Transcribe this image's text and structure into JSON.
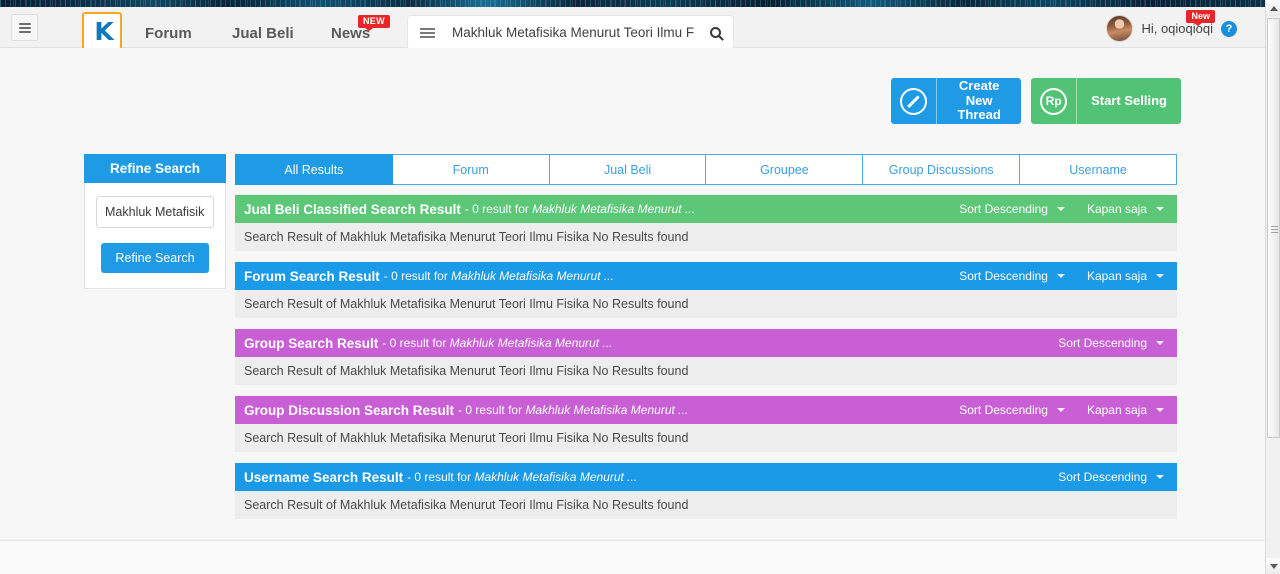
{
  "header": {
    "menu_icon": "hamburger-icon",
    "logo_glyph": "K",
    "nav": [
      {
        "label": "Forum"
      },
      {
        "label": "Jual Beli"
      },
      {
        "label": "News",
        "badge": "NEW"
      }
    ],
    "search": {
      "menu_icon": "hamburger-icon",
      "value": "Makhluk Metafisika Menurut Teori Ilmu Fisika",
      "placeholder": "Search",
      "button_icon": "search-icon"
    },
    "user": {
      "greeting": "Hi, oqioqioqi",
      "badge": "New",
      "help_label": "?",
      "avatar_icon": "avatar-image"
    }
  },
  "actions": [
    {
      "icon": "pencil-icon",
      "label": "Create New Thread",
      "color": "#1f9ae5"
    },
    {
      "icon": "rupiah-icon",
      "icon_text": "Rp",
      "label": "Start Selling",
      "color": "#52c375"
    }
  ],
  "sidebar": {
    "heading": "Refine Search",
    "input_value": "Makhluk Metafisika Menurut Teori Ilmu Fisika",
    "input_placeholder": "Search keyword",
    "button_label": "Refine Search"
  },
  "tabs": [
    {
      "label": "All Results",
      "active": true
    },
    {
      "label": "Forum",
      "active": false
    },
    {
      "label": "Jual Beli",
      "active": false
    },
    {
      "label": "Groupee",
      "active": false
    },
    {
      "label": "Group Discussions",
      "active": false
    },
    {
      "label": "Username",
      "active": false
    }
  ],
  "results": [
    {
      "title": "Jual Beli Classified Search Result",
      "meta_prefix": "- 0 result for",
      "query": "Makhluk Metafisika Menurut ...",
      "color": "#5cc777",
      "sort_label": "Sort Descending",
      "time_label": "Kapan saja",
      "body": "Search Result of Makhluk Metafisika Menurut Teori Ilmu Fisika No Results found"
    },
    {
      "title": "Forum Search Result",
      "meta_prefix": "- 0 result for",
      "query": "Makhluk Metafisika Menurut ...",
      "color": "#1b9ae8",
      "sort_label": "Sort Descending",
      "time_label": "Kapan saja",
      "body": "Search Result of Makhluk Metafisika Menurut Teori Ilmu Fisika No Results found"
    },
    {
      "title": "Group Search Result",
      "meta_prefix": "- 0 result for",
      "query": "Makhluk Metafisika Menurut ...",
      "color": "#c95fd4",
      "sort_label": "Sort Descending",
      "time_label": "",
      "body": "Search Result of Makhluk Metafisika Menurut Teori Ilmu Fisika No Results found"
    },
    {
      "title": "Group Discussion Search Result",
      "meta_prefix": "- 0 result for",
      "query": "Makhluk Metafisika Menurut ...",
      "color": "#c95fd4",
      "sort_label": "Sort Descending",
      "time_label": "Kapan saja",
      "body": "Search Result of Makhluk Metafisika Menurut Teori Ilmu Fisika No Results found"
    },
    {
      "title": "Username Search Result",
      "meta_prefix": "- 0 result for",
      "query": "Makhluk Metafisika Menurut ...",
      "color": "#1b9ae8",
      "sort_label": "Sort Descending",
      "time_label": "",
      "body": "Search Result of Makhluk Metafisika Menurut Teori Ilmu Fisika No Results found"
    }
  ],
  "scrollbar": {
    "up_icon": "chevron-up-icon",
    "down_icon": "chevron-down-icon"
  }
}
